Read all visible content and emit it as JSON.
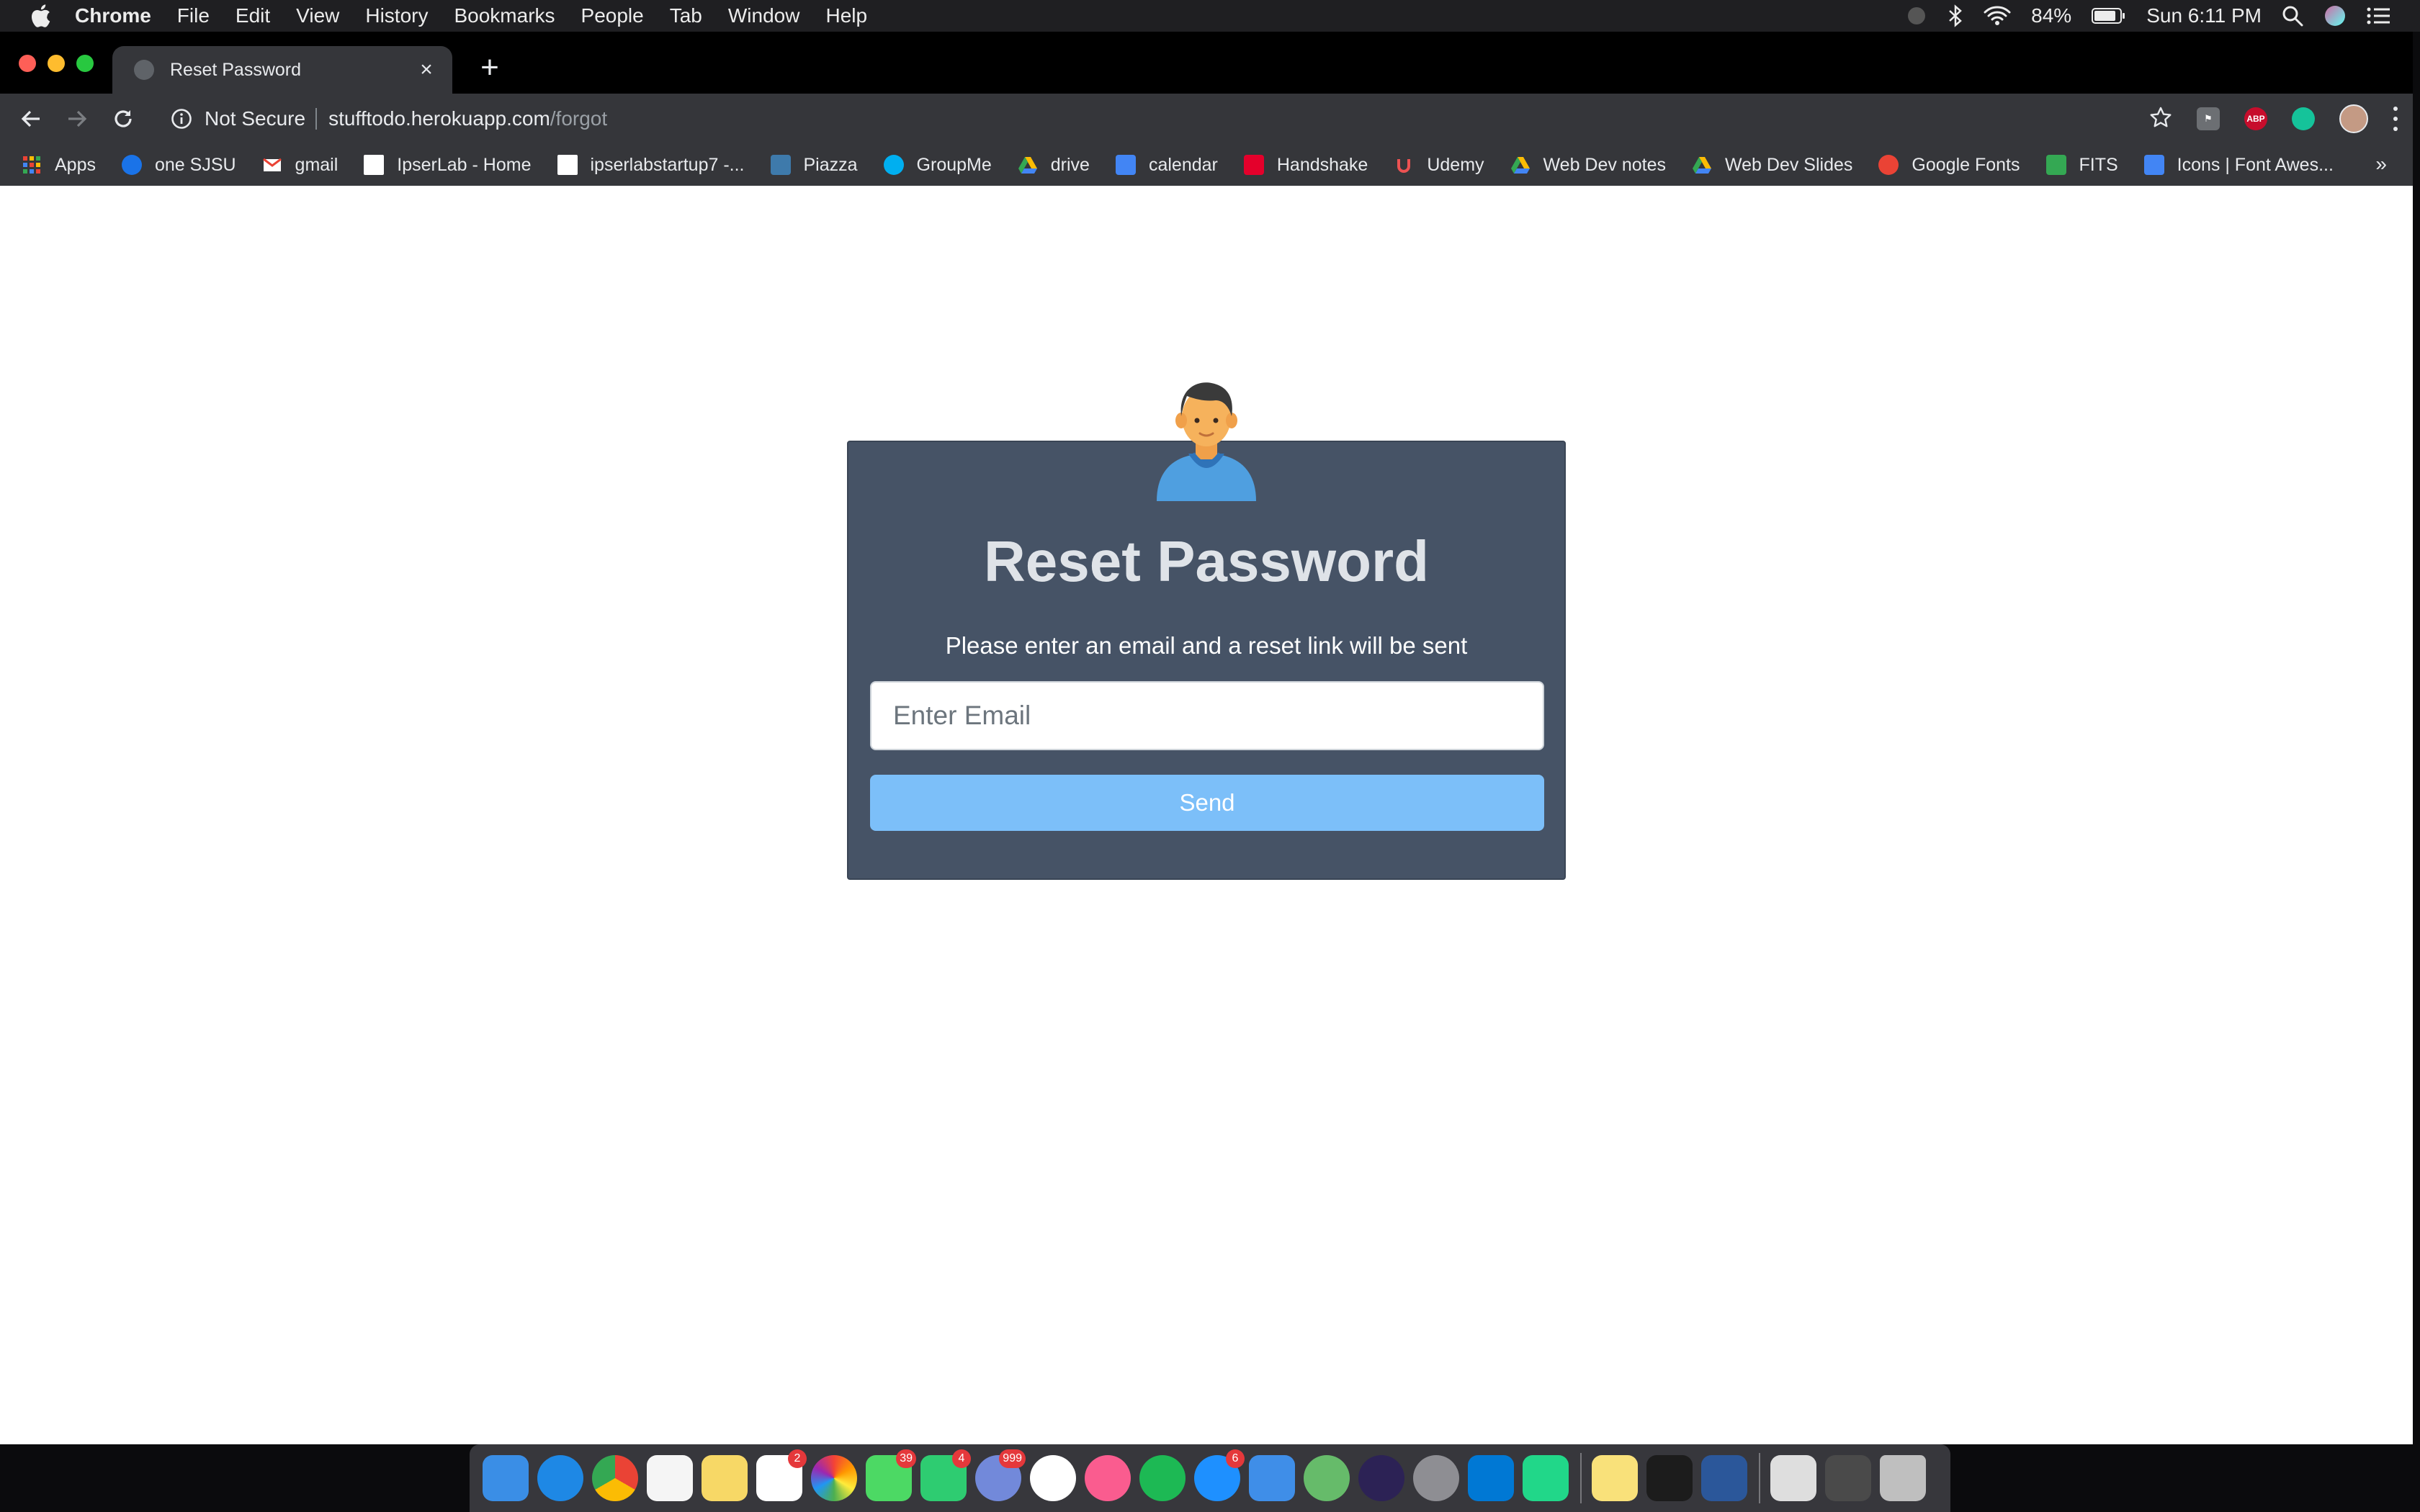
{
  "menubar": {
    "app_name": "Chrome",
    "menus": [
      "File",
      "Edit",
      "View",
      "History",
      "Bookmarks",
      "People",
      "Tab",
      "Window",
      "Help"
    ],
    "battery": "84%",
    "clock": "Sun 6:11 PM"
  },
  "browser": {
    "tab_title": "Reset Password",
    "security_label": "Not Secure",
    "url_host": "stufftodo.herokuapp.com",
    "url_path": "/forgot",
    "extensions": [
      "abp-icon"
    ],
    "bookmarks": [
      {
        "label": "Apps",
        "icon": "apps-grid-icon",
        "color": "#ea4335"
      },
      {
        "label": "one SJSU",
        "icon": "sjsu-icon",
        "color": "#1a73e8"
      },
      {
        "label": "gmail",
        "icon": "gmail-icon",
        "color": "#ffffff"
      },
      {
        "label": "IpserLab - Home",
        "icon": "page-icon",
        "color": "#ffffff"
      },
      {
        "label": "ipserlabstartup7 -...",
        "icon": "page-icon",
        "color": "#ffffff"
      },
      {
        "label": "Piazza",
        "icon": "piazza-icon",
        "color": "#3e7aab"
      },
      {
        "label": "GroupMe",
        "icon": "groupme-icon",
        "color": "#00aff0"
      },
      {
        "label": "drive",
        "icon": "drive-icon",
        "color": "#fbbc04"
      },
      {
        "label": "calendar",
        "icon": "calendar-icon",
        "color": "#4285f4"
      },
      {
        "label": "Handshake",
        "icon": "handshake-icon",
        "color": "#e4002b"
      },
      {
        "label": "Udemy",
        "icon": "udemy-icon",
        "color": "#ec5252"
      },
      {
        "label": "Web Dev notes",
        "icon": "drive-icon",
        "color": "#fbbc04"
      },
      {
        "label": "Web Dev Slides",
        "icon": "drive-icon",
        "color": "#fbbc04"
      },
      {
        "label": "Google Fonts",
        "icon": "google-fonts-icon",
        "color": "#ea4335"
      },
      {
        "label": "FITS",
        "icon": "fits-icon",
        "color": "#34a853"
      },
      {
        "label": "Icons | Font Awes...",
        "icon": "flag-icon",
        "color": "#4285f4"
      }
    ],
    "more_bookmarks": "»"
  },
  "reset_form": {
    "title": "Reset Password",
    "subtitle": "Please enter an email and a reset link will be sent",
    "email_placeholder": "Enter Email",
    "email_value": "",
    "send_label": "Send",
    "colors": {
      "card": "#465366",
      "button": "#7cbff9",
      "title": "#dfe3e8"
    }
  },
  "dock": {
    "apps": [
      {
        "name": "finder-icon",
        "color": "#3a8ee6",
        "badge": ""
      },
      {
        "name": "safari-icon",
        "color": "#1e88e5",
        "badge": ""
      },
      {
        "name": "chrome-icon",
        "color": "#34a853",
        "badge": ""
      },
      {
        "name": "calendar-app-icon",
        "color": "#f5f5f5",
        "badge": ""
      },
      {
        "name": "notes-icon",
        "color": "#f7d866",
        "badge": ""
      },
      {
        "name": "reminders-icon",
        "color": "#ffffff",
        "badge": "2"
      },
      {
        "name": "photos-icon",
        "color": "#f0a030",
        "badge": ""
      },
      {
        "name": "messages-icon",
        "color": "#4cd964",
        "badge": "39"
      },
      {
        "name": "facetime-icon",
        "color": "#2ecc71",
        "badge": "4"
      },
      {
        "name": "discord-icon",
        "color": "#7289da",
        "badge": "999"
      },
      {
        "name": "slack-icon",
        "color": "#ffffff",
        "badge": ""
      },
      {
        "name": "itunes-icon",
        "color": "#fa5c8f",
        "badge": ""
      },
      {
        "name": "spotify-icon",
        "color": "#1db954",
        "badge": ""
      },
      {
        "name": "app-store-icon",
        "color": "#1e90ff",
        "badge": "6"
      },
      {
        "name": "xcode-icon",
        "color": "#3f8ee8",
        "badge": ""
      },
      {
        "name": "atom-icon",
        "color": "#66bb6a",
        "badge": ""
      },
      {
        "name": "eclipse-icon",
        "color": "#2c2255",
        "badge": ""
      },
      {
        "name": "system-preferences-icon",
        "color": "#8e8e93",
        "badge": ""
      },
      {
        "name": "vscode-icon",
        "color": "#0078d4",
        "badge": ""
      },
      {
        "name": "pycharm-icon",
        "color": "#21d789",
        "badge": ""
      },
      {
        "name": "stickies-icon",
        "color": "#f9e17a",
        "badge": ""
      },
      {
        "name": "terminal-icon",
        "color": "#1c1c1c",
        "badge": ""
      },
      {
        "name": "word-icon",
        "color": "#2b579a",
        "badge": ""
      }
    ],
    "right_items": [
      {
        "name": "documents-stack-icon",
        "color": "#dedede"
      },
      {
        "name": "screenshots-stack-icon",
        "color": "#4a4a4a"
      },
      {
        "name": "trash-icon",
        "color": "#bfbfbf"
      }
    ]
  }
}
